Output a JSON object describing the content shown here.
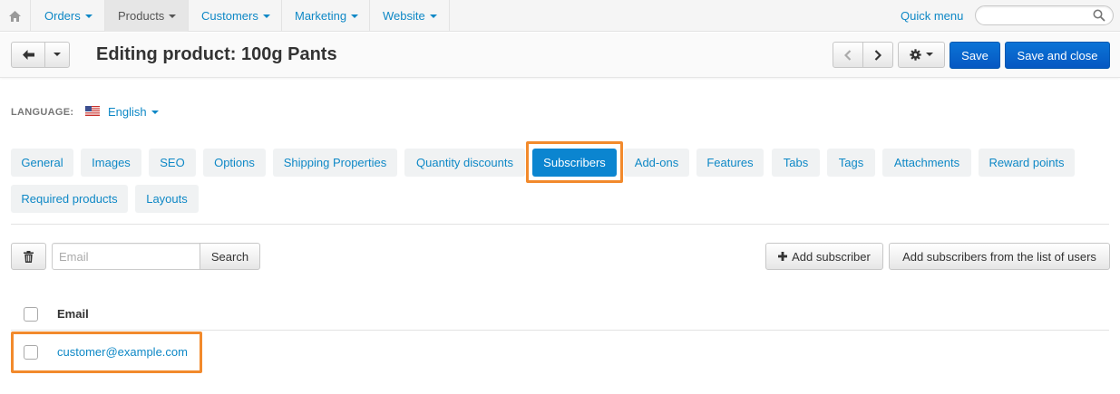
{
  "nav": {
    "home_icon": "home-icon",
    "items": [
      {
        "label": "Orders"
      },
      {
        "label": "Products"
      },
      {
        "label": "Customers"
      },
      {
        "label": "Marketing"
      },
      {
        "label": "Website"
      }
    ],
    "quick_menu": "Quick menu",
    "search_icon": "search-icon"
  },
  "header": {
    "title": "Editing product: 100g Pants",
    "save_label": "Save",
    "save_close_label": "Save and close"
  },
  "language": {
    "label": "LANGUAGE:",
    "value": "English",
    "flag_icon": "us-flag-icon"
  },
  "tabs": [
    {
      "label": "General"
    },
    {
      "label": "Images"
    },
    {
      "label": "SEO"
    },
    {
      "label": "Options"
    },
    {
      "label": "Shipping Properties"
    },
    {
      "label": "Quantity discounts"
    },
    {
      "label": "Subscribers",
      "active": true
    },
    {
      "label": "Add-ons"
    },
    {
      "label": "Features"
    },
    {
      "label": "Tabs"
    },
    {
      "label": "Tags"
    },
    {
      "label": "Attachments"
    },
    {
      "label": "Reward points"
    },
    {
      "label": "Required products"
    },
    {
      "label": "Layouts"
    }
  ],
  "toolbar": {
    "email_placeholder": "Email",
    "search_label": "Search",
    "add_subscriber_label": "Add subscriber",
    "add_from_users_label": "Add subscribers from the list of users"
  },
  "table": {
    "header_email": "Email",
    "rows": [
      {
        "email": "customer@example.com"
      }
    ]
  },
  "colors": {
    "accent": "#0e88c6",
    "primary_button": "#0b6fd3",
    "active_tab": "#0b85d0",
    "highlight": "#f28a2c"
  }
}
